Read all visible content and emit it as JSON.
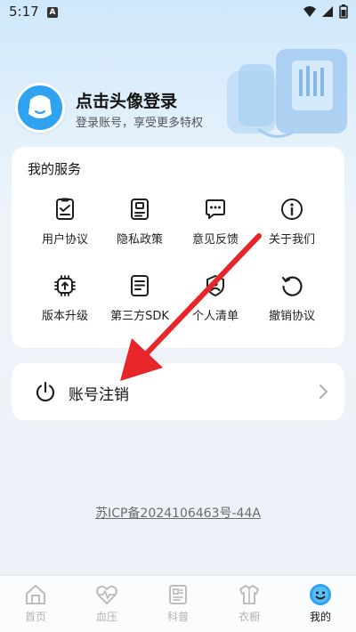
{
  "status_bar": {
    "time": "5:17",
    "notif_badge": "A"
  },
  "profile": {
    "title": "点击头像登录",
    "subtitle": "登录账号，享受更多特权"
  },
  "services": {
    "title": "我的服务",
    "items": [
      {
        "label": "用户协议",
        "icon": "document-check-icon"
      },
      {
        "label": "隐私政策",
        "icon": "clipboard-icon"
      },
      {
        "label": "意见反馈",
        "icon": "chat-bubble-icon"
      },
      {
        "label": "关于我们",
        "icon": "info-circle-icon"
      },
      {
        "label": "版本升级",
        "icon": "upgrade-chip-icon"
      },
      {
        "label": "第三方SDK",
        "icon": "list-document-icon"
      },
      {
        "label": "个人清单",
        "icon": "shield-person-icon"
      },
      {
        "label": "撤销协议",
        "icon": "undo-circle-icon"
      }
    ]
  },
  "account": {
    "cancel_label": "账号注销"
  },
  "footer": {
    "icp": "苏ICP备2024106463号-44A"
  },
  "nav": {
    "items": [
      {
        "label": "首页",
        "icon": "home-icon"
      },
      {
        "label": "血压",
        "icon": "heart-pulse-icon"
      },
      {
        "label": "科普",
        "icon": "article-icon"
      },
      {
        "label": "衣橱",
        "icon": "wardrobe-icon"
      },
      {
        "label": "我的",
        "icon": "smile-face-icon",
        "active": true
      }
    ]
  },
  "colors": {
    "accent": "#2fa3f0",
    "annotation_arrow": "#e8262a",
    "icon_dark": "#1f1f1f"
  }
}
